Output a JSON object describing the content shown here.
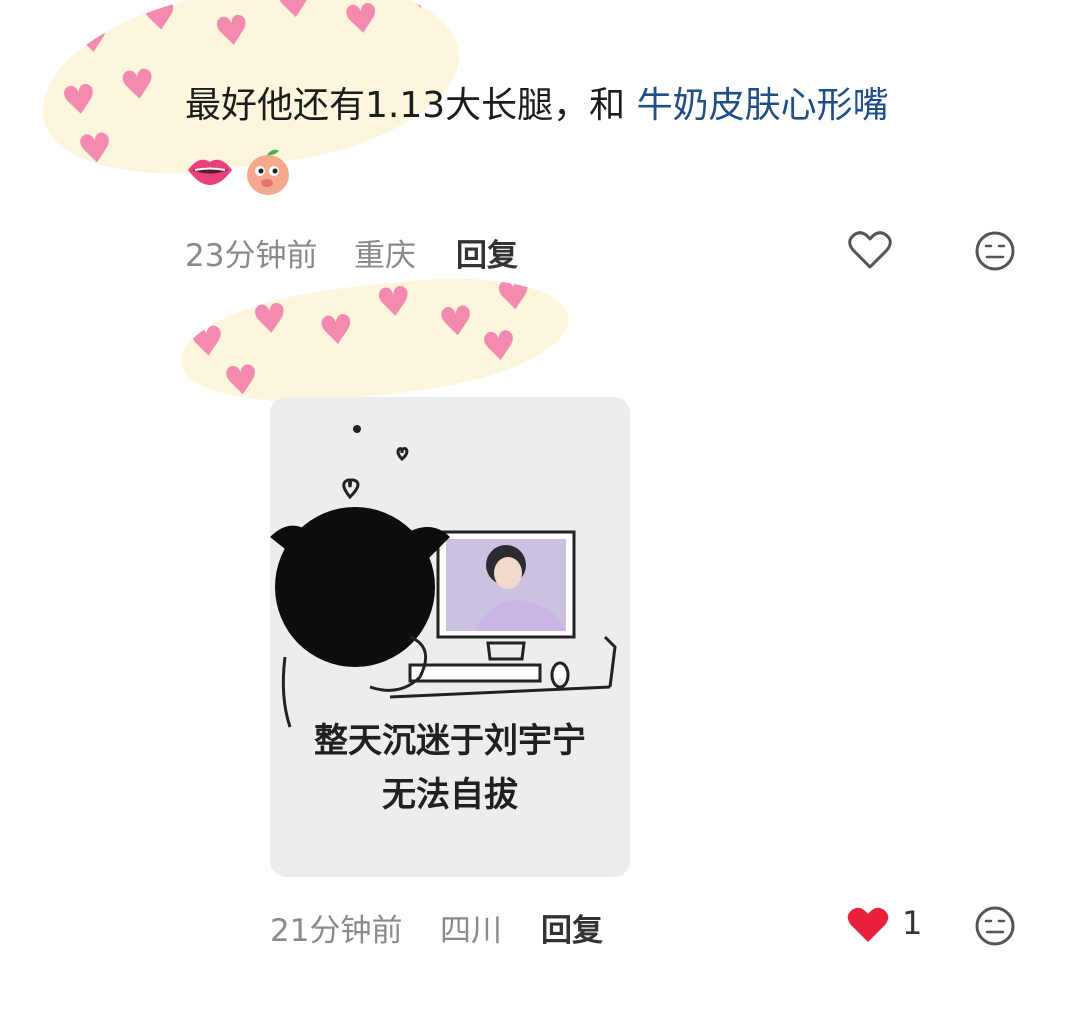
{
  "comment1": {
    "text_plain": "最好他还有1.13大长腿，和 ",
    "text_link": "牛奶皮肤心形嘴",
    "emojis": [
      "lips-emoji",
      "peach-emoji"
    ],
    "time": "23分钟前",
    "location": "重庆",
    "reply_label": "回复"
  },
  "comment2": {
    "image_caption_line1": "整天沉迷于刘宇宁",
    "image_caption_line2": "无法自拔",
    "time": "21分钟前",
    "location": "四川",
    "reply_label": "回复",
    "like_count": "1"
  },
  "colors": {
    "link": "#1f4f86",
    "liked_heart": "#e8203c",
    "sticker_heart": "#f58ab0",
    "sticker_bg": "#fbf6dc"
  },
  "icons": {
    "like_outline": "heart-outline-icon",
    "like_filled": "heart-filled-icon",
    "dislike": "neutral-face-icon"
  }
}
